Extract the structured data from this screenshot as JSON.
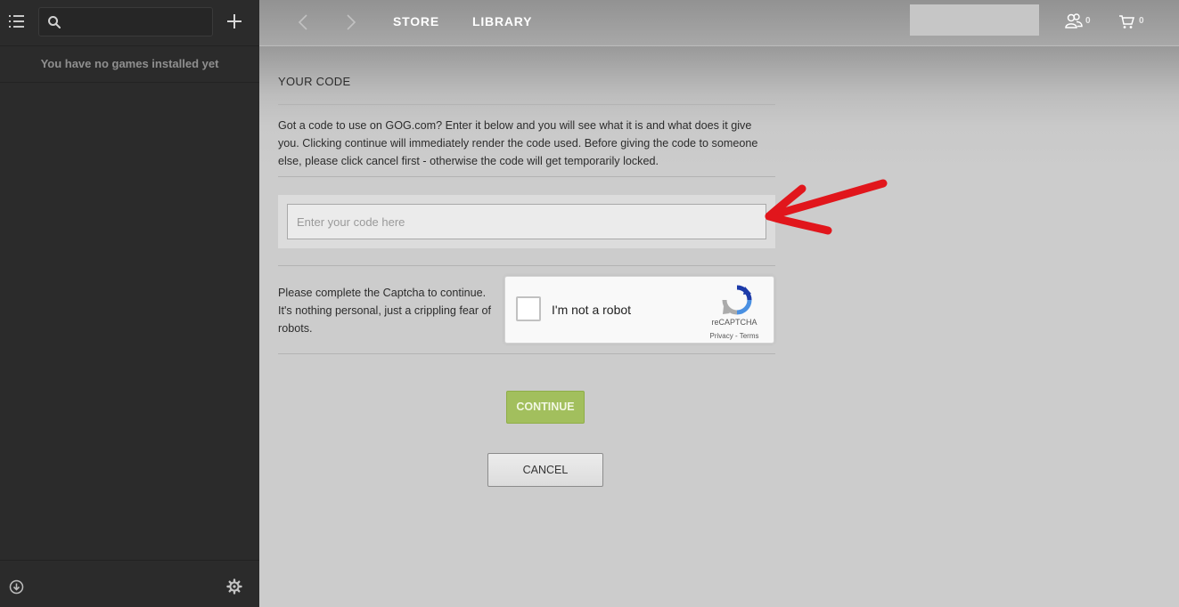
{
  "sidebar": {
    "search": {
      "value": "",
      "placeholder": ""
    },
    "empty_message": "You have no games installed yet"
  },
  "topbar": {
    "store_label": "STORE",
    "library_label": "LIBRARY",
    "friends_count": "0",
    "cart_count": "0"
  },
  "redeem": {
    "heading": "YOUR CODE",
    "intro": "Got a code to use on GOG.com? Enter it below and you will see what it is and what does it give you. Clicking continue will immediately render the code used. Before giving the code to someone else, please click cancel first - otherwise the code will get temporarily locked.",
    "code_input": {
      "value": "",
      "placeholder": "Enter your code here"
    },
    "captcha_text": "Please complete the Captcha to continue. It's nothing personal, just a crippling fear of robots.",
    "recaptcha": {
      "label": "I'm not a robot",
      "brand": "reCAPTCHA",
      "privacy": "Privacy",
      "separator": " - ",
      "terms": "Terms"
    },
    "continue_label": "CONTINUE",
    "cancel_label": "CANCEL"
  },
  "colors": {
    "accent_green": "#a2bf5d",
    "annotation_red": "#e1161c",
    "sidebar_bg": "#2b2b2b"
  },
  "icons": [
    "list-icon",
    "search-icon",
    "plus-icon",
    "download-icon",
    "gear-icon",
    "chevron-left-icon",
    "chevron-right-icon",
    "friends-icon",
    "cart-icon",
    "recaptcha-logo-icon",
    "red-arrow-annotation"
  ]
}
